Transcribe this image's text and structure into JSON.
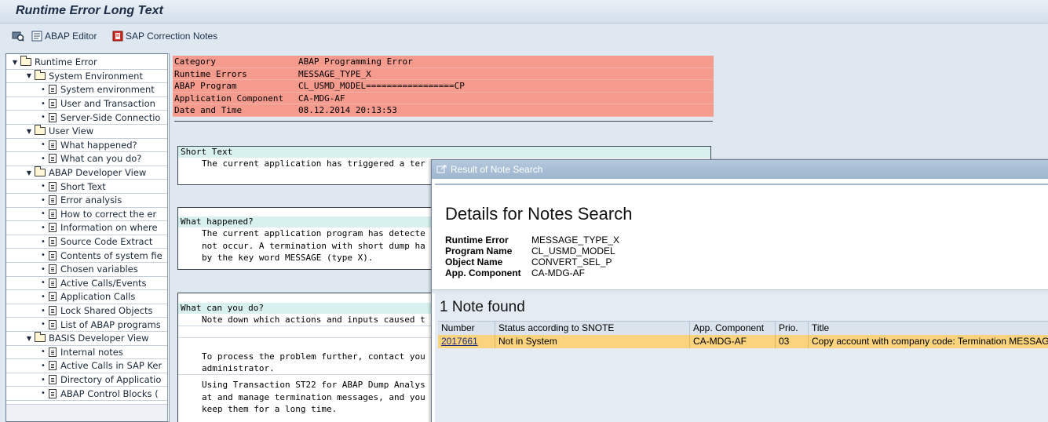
{
  "window": {
    "title": "Runtime Error Long Text"
  },
  "toolbar": {
    "abap_editor": "ABAP Editor",
    "correction_notes": "SAP Correction Notes"
  },
  "tree": [
    {
      "level": 0,
      "type": "folder",
      "label": "Runtime Error"
    },
    {
      "level": 1,
      "type": "folder",
      "label": "System Environment"
    },
    {
      "level": 2,
      "type": "doc",
      "label": "System environment"
    },
    {
      "level": 2,
      "type": "doc",
      "label": "User and Transaction"
    },
    {
      "level": 2,
      "type": "doc",
      "label": "Server-Side Connectio"
    },
    {
      "level": 1,
      "type": "folder",
      "label": "User View"
    },
    {
      "level": 2,
      "type": "doc",
      "label": "What happened?"
    },
    {
      "level": 2,
      "type": "doc",
      "label": "What can you do?"
    },
    {
      "level": 1,
      "type": "folder",
      "label": "ABAP Developer View"
    },
    {
      "level": 2,
      "type": "doc",
      "label": "Short Text"
    },
    {
      "level": 2,
      "type": "doc",
      "label": "Error analysis"
    },
    {
      "level": 2,
      "type": "doc",
      "label": "How to correct the er"
    },
    {
      "level": 2,
      "type": "doc",
      "label": "Information on where"
    },
    {
      "level": 2,
      "type": "doc",
      "label": "Source Code Extract"
    },
    {
      "level": 2,
      "type": "doc",
      "label": "Contents of system fie"
    },
    {
      "level": 2,
      "type": "doc",
      "label": "Chosen variables"
    },
    {
      "level": 2,
      "type": "doc",
      "label": "Active Calls/Events"
    },
    {
      "level": 2,
      "type": "doc",
      "label": "Application Calls"
    },
    {
      "level": 2,
      "type": "doc",
      "label": "Lock Shared Objects"
    },
    {
      "level": 2,
      "type": "doc",
      "label": "List of ABAP programs"
    },
    {
      "level": 1,
      "type": "folder",
      "label": "BASIS Developer View"
    },
    {
      "level": 2,
      "type": "doc",
      "label": "Internal notes"
    },
    {
      "level": 2,
      "type": "doc",
      "label": "Active Calls in SAP Ker"
    },
    {
      "level": 2,
      "type": "doc",
      "label": "Directory of Applicatio"
    },
    {
      "level": 2,
      "type": "doc",
      "label": "ABAP Control Blocks ("
    }
  ],
  "header": [
    {
      "key": "Category",
      "value": "ABAP Programming Error"
    },
    {
      "key": "Runtime Errors",
      "value": "MESSAGE_TYPE_X"
    },
    {
      "key": "ABAP Program",
      "value": "CL_USMD_MODEL=================CP"
    },
    {
      "key": "Application Component",
      "value": "CA-MDG-AF"
    },
    {
      "key": "Date and Time",
      "value": "08.12.2014 20:13:53"
    }
  ],
  "short_text": {
    "heading": "Short Text",
    "lines": [
      "The current application has triggered a ter"
    ]
  },
  "what_happened": {
    "heading": "What happened?",
    "lines": [
      "The current application program has detecte",
      "not occur. A termination with short dump ha",
      "by the key word MESSAGE (type X)."
    ]
  },
  "what_can_you_do": {
    "heading": "What can you do?",
    "lines": [
      "Note down which actions and inputs caused t",
      "",
      "",
      "To process the problem further, contact you",
      "administrator.",
      "",
      "Using Transaction ST22 for ABAP Dump Analys",
      "at and manage termination messages, and you",
      "keep them for a long time."
    ]
  },
  "popup": {
    "title": "Result of Note Search",
    "heading": "Details for Notes Search",
    "details": [
      {
        "key": "Runtime Error",
        "value": "MESSAGE_TYPE_X"
      },
      {
        "key": "Program Name",
        "value": "CL_USMD_MODEL"
      },
      {
        "key": "Object Name",
        "value": "CONVERT_SEL_P"
      },
      {
        "key": "App. Component",
        "value": "CA-MDG-AF"
      }
    ],
    "found_label": "1 Note found",
    "columns": [
      "Number",
      "Status according to SNOTE",
      "App. Component",
      "Prio.",
      "Title"
    ],
    "rows": [
      {
        "number": "2017661",
        "status": "Not in System",
        "component": "CA-MDG-AF",
        "prio": "03",
        "title": "Copy account with company code: Termination MESSAG"
      }
    ]
  }
}
